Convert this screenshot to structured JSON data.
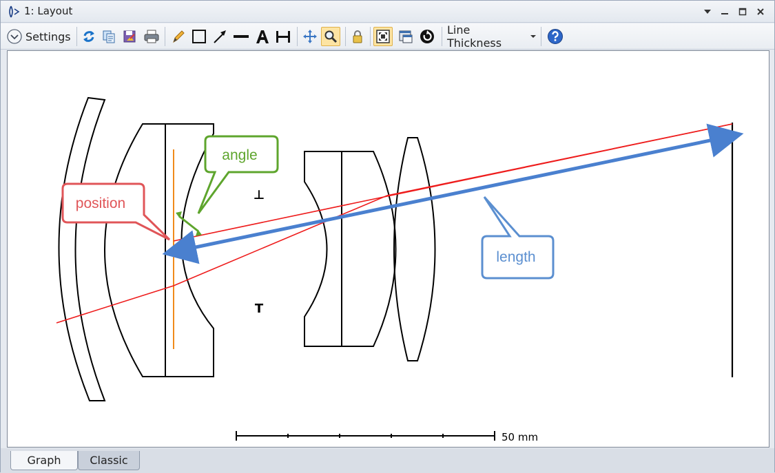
{
  "window": {
    "title": "1: Layout",
    "controls": [
      "dropdown",
      "minimize",
      "maximize",
      "close"
    ]
  },
  "toolbar": {
    "settings_label": "Settings",
    "line_thickness_label": "Line Thickness",
    "icons": [
      "refresh-icon",
      "copy-icon",
      "save-icon",
      "print-icon",
      "pencil-icon",
      "rectangle-icon",
      "arrow-icon",
      "line-icon",
      "text-icon",
      "dimension-icon",
      "pan-icon",
      "zoom-icon",
      "lock-icon",
      "fit-icon",
      "window-icon",
      "reset-icon",
      "help-icon"
    ],
    "active": [
      "zoom-icon",
      "fit-icon"
    ]
  },
  "layout": {
    "scale_bar_label": "50 mm",
    "callouts": {
      "angle": "angle",
      "position": "position",
      "length": "length"
    },
    "stop_markers": [
      "⊥",
      "T"
    ],
    "colors": {
      "angle": "#5ea52d",
      "position": "#e05558",
      "length": "#5b8fd0",
      "ray": "#ee1c1c",
      "stop": "#f08a1a"
    }
  },
  "tabs": {
    "graph": "Graph",
    "classic": "Classic",
    "active": "Graph"
  }
}
